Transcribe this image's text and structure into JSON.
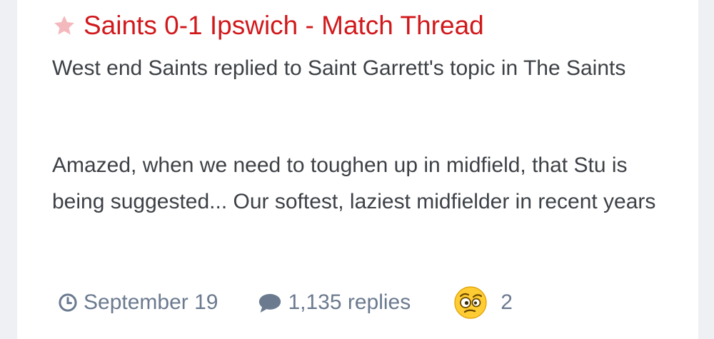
{
  "post": {
    "title": "Saints 0-1 Ipswich - Match Thread",
    "activity": "West end Saints replied to Saint Garrett's topic in The Saints",
    "snippet": "Amazed, when we need to toughen up in midfield, that Stu is being suggested... Our softest, laziest midfielder in recent years"
  },
  "meta": {
    "date": "September 19",
    "replies": "1,135 replies",
    "reaction_count": "2"
  },
  "icons": {
    "featured": "star-icon",
    "date": "clock-icon",
    "replies": "comment-icon",
    "reaction": "confused-emoji-icon"
  },
  "colors": {
    "title": "#d1191c",
    "star": "#f4b9bc",
    "meta": "#6b7a8f",
    "body_text": "#3d4146",
    "background": "#eef0f3"
  }
}
